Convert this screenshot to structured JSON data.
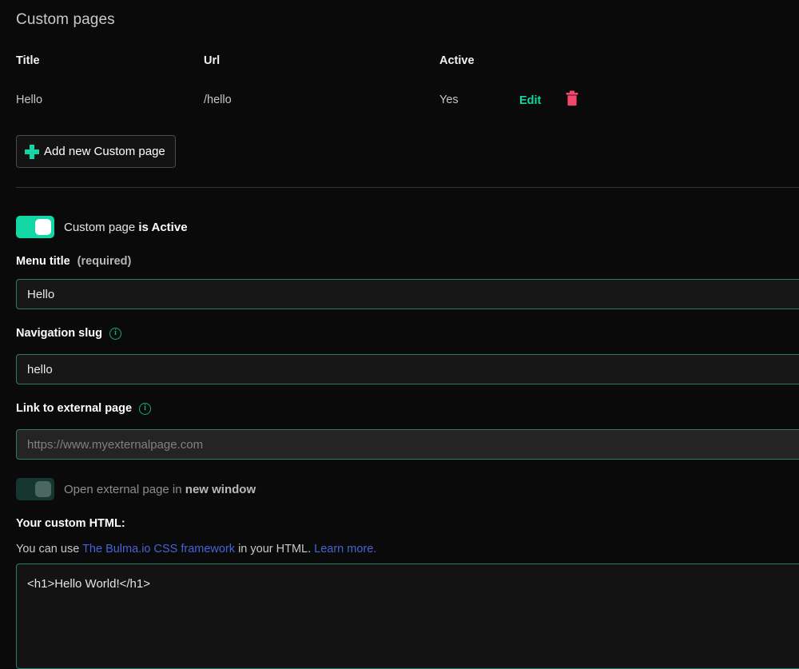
{
  "header": {
    "title": "Custom pages"
  },
  "pages_table": {
    "columns": [
      "Title",
      "Url",
      "Active"
    ],
    "rows": [
      {
        "title": "Hello",
        "url": "/hello",
        "active": "Yes",
        "edit_label": "Edit",
        "delete_icon": "trash-icon"
      }
    ]
  },
  "add_button": {
    "label": "Add new Custom page",
    "icon": "plus-icon"
  },
  "form": {
    "active_toggle": {
      "label_prefix": "Custom page ",
      "label_strong": "is Active",
      "state": "on"
    },
    "menu_title": {
      "label": "Menu title",
      "label_note": "(required)",
      "value": "Hello"
    },
    "navigation_slug": {
      "label": "Navigation slug",
      "info_icon": "info-icon",
      "value": "hello"
    },
    "external_link": {
      "label": "Link to external page",
      "info_icon": "info-icon",
      "value": "",
      "placeholder": "https://www.myexternalpage.com"
    },
    "new_window_toggle": {
      "label_prefix": "Open external page in ",
      "label_strong": "new window",
      "state": "disabled-on"
    },
    "custom_html": {
      "label": "Your custom HTML:",
      "help_prefix": "You can use ",
      "help_link": "The Bulma.io CSS framework",
      "help_middle": " in your HTML. ",
      "help_link2": "Learn more.",
      "value": "<h1>Hello World!</h1>"
    }
  },
  "colors": {
    "background": "#0a0a0a",
    "accent_teal": "#12d6a4",
    "border_teal": "#2e7a65",
    "danger_pink": "#f2476a",
    "link_blue": "#4763d6",
    "divider": "#343434"
  }
}
